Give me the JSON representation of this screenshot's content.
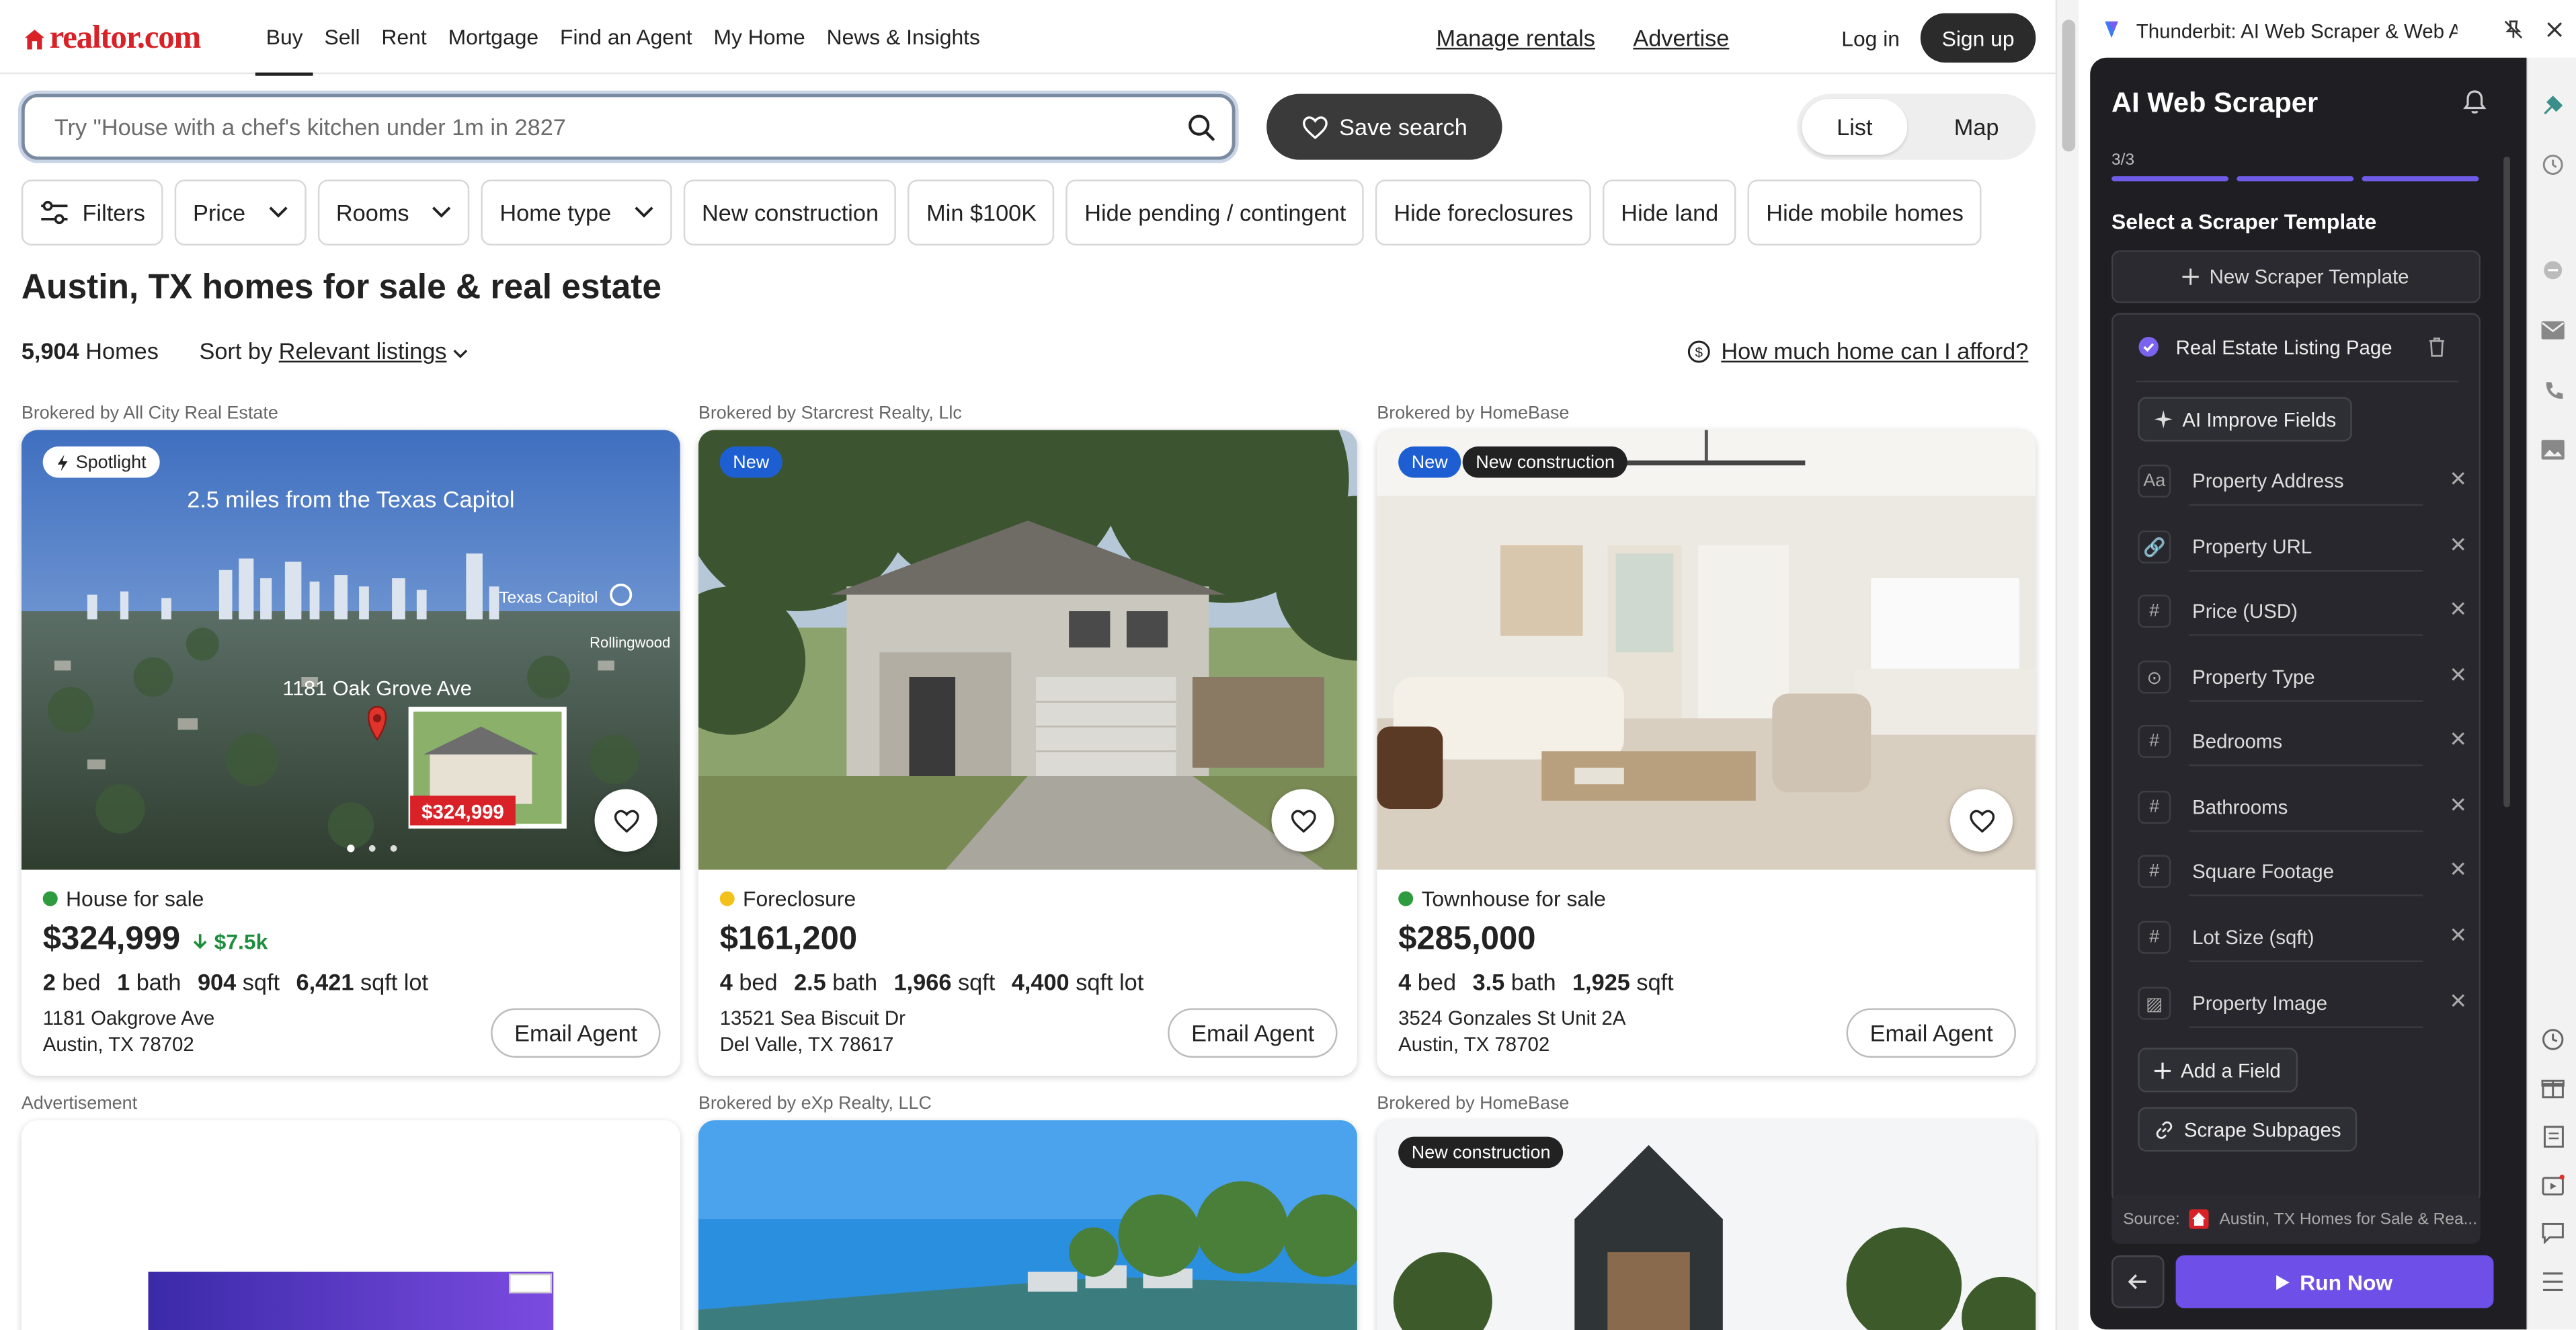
{
  "nav": {
    "logo": "realtor.com",
    "links": [
      "Buy",
      "Sell",
      "Rent",
      "Mortgage",
      "Find an Agent",
      "My Home",
      "News & Insights"
    ],
    "manage_rentals": "Manage rentals",
    "advertise": "Advertise",
    "login": "Log in",
    "signup": "Sign up"
  },
  "search": {
    "placeholder": "Try \"House with a chef's kitchen under 1m in 2827",
    "save_label": "Save search",
    "view_list": "List",
    "view_map": "Map"
  },
  "filters": [
    "Filters",
    "Price",
    "Rooms",
    "Home type",
    "New construction",
    "Min $100K",
    "Hide pending / contingent",
    "Hide foreclosures",
    "Hide land",
    "Hide mobile homes"
  ],
  "listing_header": {
    "title": "Austin, TX homes for sale & real estate",
    "count_value": "5,904",
    "count_label": "Homes",
    "sort_prefix": "Sort by",
    "sort_value": "Relevant listings",
    "afford": "How much home can I afford?"
  },
  "cards": [
    {
      "broker": "Brokered by All City Real Estate",
      "badges": [
        "Spotlight"
      ],
      "photo_caption": "2.5 miles from the Texas Capitol",
      "photo_street": "1181 Oak Grove Ave",
      "photo_landmark": "Texas Capitol",
      "photo_area": "Rollingwood",
      "photo_price": "$324,999",
      "status": "House for sale",
      "status_color": "#2e9b3e",
      "price": "$324,999",
      "price_drop": "$7.5k",
      "beds": "2",
      "beds_label": "bed",
      "baths": "1",
      "baths_label": "bath",
      "sqft": "904",
      "sqft_label": "sqft",
      "lot": "6,421",
      "lot_label": "sqft lot",
      "street": "1181 Oakgrove Ave",
      "city": "Austin, TX 78702",
      "email": "Email Agent"
    },
    {
      "broker": "Brokered by Starcrest Realty, Llc",
      "badges": [
        "New"
      ],
      "status": "Foreclosure",
      "status_color": "#f2c21b",
      "price": "$161,200",
      "beds": "4",
      "beds_label": "bed",
      "baths": "2.5",
      "baths_label": "bath",
      "sqft": "1,966",
      "sqft_label": "sqft",
      "lot": "4,400",
      "lot_label": "sqft lot",
      "street": "13521 Sea Biscuit Dr",
      "city": "Del Valle, TX 78617",
      "email": "Email Agent"
    },
    {
      "broker": "Brokered by HomeBase",
      "badges": [
        "New",
        "New construction"
      ],
      "status": "Townhouse for sale",
      "status_color": "#2e9b3e",
      "price": "$285,000",
      "beds": "4",
      "beds_label": "bed",
      "baths": "3.5",
      "baths_label": "bath",
      "sqft": "1,925",
      "sqft_label": "sqft",
      "street": "3524 Gonzales St Unit 2A",
      "city": "Austin, TX 78702",
      "email": "Email Agent"
    }
  ],
  "row2": {
    "advertisement": "Advertisement",
    "broker2": "Brokered by eXp Realty, LLC",
    "broker3": "Brokered by HomeBase",
    "badge3": "New construction"
  },
  "extension": {
    "tab_title": "Thunderbit: AI Web Scraper & Web A...",
    "title": "AI Web Scraper",
    "step": "3/3",
    "section_title": "Select a Scraper Template",
    "new_template": "New Scraper Template",
    "template_name": "Real Estate Listing Page",
    "ai_improve": "AI Improve Fields",
    "fields": [
      {
        "label": "Property Address",
        "icon": "text-type-icon"
      },
      {
        "label": "Property URL",
        "icon": "link-icon"
      },
      {
        "label": "Price (USD)",
        "icon": "hash-icon"
      },
      {
        "label": "Property Type",
        "icon": "select-icon"
      },
      {
        "label": "Bedrooms",
        "icon": "hash-icon"
      },
      {
        "label": "Bathrooms",
        "icon": "hash-icon"
      },
      {
        "label": "Square Footage",
        "icon": "hash-icon"
      },
      {
        "label": "Lot Size (sqft)",
        "icon": "hash-icon"
      },
      {
        "label": "Property Image",
        "icon": "image-icon"
      }
    ],
    "add_field": "Add a Field",
    "scrape_subpages": "Scrape Subpages",
    "source_label": "Source:",
    "source_value": "Austin, TX Homes for Sale & Rea...",
    "run_now": "Run Now",
    "accent": "#6e4fe8"
  }
}
